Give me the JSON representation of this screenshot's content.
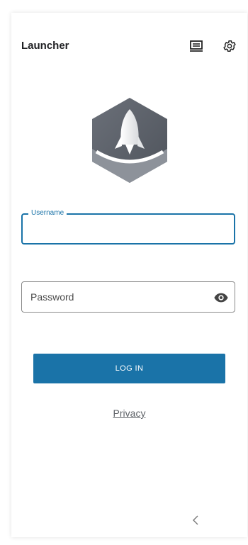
{
  "header": {
    "title": "Launcher",
    "icons": [
      "screen-icon",
      "gear-icon"
    ]
  },
  "logo": {
    "icon": "rocket-hexagon-logo"
  },
  "form": {
    "username": {
      "label": "Username",
      "value": "",
      "placeholder": ""
    },
    "password": {
      "placeholder": "Password",
      "value": "",
      "toggle_icon": "eye-icon"
    },
    "login_label": "LOG IN"
  },
  "footer": {
    "privacy_label": "Privacy",
    "back_icon": "chevron-left-icon"
  },
  "colors": {
    "accent": "#1a73a8",
    "logo_dark": "#5f6670",
    "logo_light": "#9aa0a6"
  }
}
